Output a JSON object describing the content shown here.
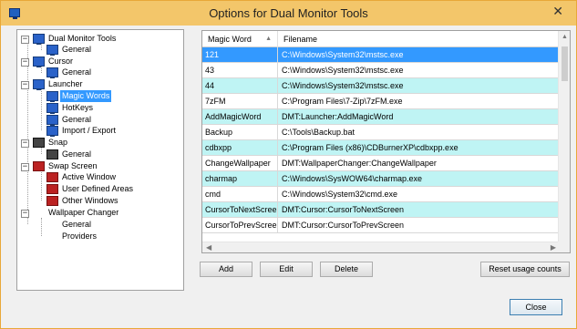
{
  "window": {
    "title": "Options for Dual Monitor Tools",
    "close_glyph": "✕"
  },
  "tree": {
    "nodes": [
      {
        "label": "Dual Monitor Tools",
        "icon": "monitor-icon",
        "expanded": true
      },
      {
        "label": "General",
        "icon": "monitor-icon"
      },
      {
        "label": "Cursor",
        "icon": "monitor-icon",
        "expanded": true
      },
      {
        "label": "General",
        "icon": "monitor-icon"
      },
      {
        "label": "Launcher",
        "icon": "monitor-icon",
        "expanded": true
      },
      {
        "label": "Magic Words",
        "icon": "monitor-icon",
        "selected": true
      },
      {
        "label": "HotKeys",
        "icon": "monitor-icon"
      },
      {
        "label": "General",
        "icon": "monitor-icon"
      },
      {
        "label": "Import / Export",
        "icon": "monitor-icon"
      },
      {
        "label": "Snap",
        "icon": "snap-icon",
        "expanded": true
      },
      {
        "label": "General",
        "icon": "snap-icon"
      },
      {
        "label": "Swap Screen",
        "icon": "swap-screen-icon",
        "expanded": true
      },
      {
        "label": "Active Window",
        "icon": "swap-screen-icon"
      },
      {
        "label": "User Defined Areas",
        "icon": "swap-screen-icon"
      },
      {
        "label": "Other Windows",
        "icon": "swap-screen-icon"
      },
      {
        "label": "Wallpaper Changer",
        "icon": "wallpaper-icon",
        "expanded": true
      },
      {
        "label": "General",
        "icon": "wallpaper-icon"
      },
      {
        "label": "Providers",
        "icon": "wallpaper-icon"
      }
    ]
  },
  "grid": {
    "columns": [
      "Magic Word",
      "Filename"
    ],
    "sort_glyph": "▲",
    "rows": [
      [
        "121",
        "C:\\Windows\\System32\\mstsc.exe"
      ],
      [
        "43",
        "C:\\Windows\\System32\\mstsc.exe"
      ],
      [
        "44",
        "C:\\Windows\\System32\\mstsc.exe"
      ],
      [
        "7zFM",
        "C:\\Program Files\\7-Zip\\7zFM.exe"
      ],
      [
        "AddMagicWord",
        "DMT:Launcher:AddMagicWord"
      ],
      [
        "Backup",
        "C:\\Tools\\Backup.bat"
      ],
      [
        "cdbxpp",
        "C:\\Program Files (x86)\\CDBurnerXP\\cdbxpp.exe"
      ],
      [
        "ChangeWallpaper",
        "DMT:WallpaperChanger:ChangeWallpaper"
      ],
      [
        "charmap",
        "C:\\Windows\\SysWOW64\\charmap.exe"
      ],
      [
        "cmd",
        "C:\\Windows\\System32\\cmd.exe"
      ],
      [
        "CursorToNextScreen",
        "DMT:Cursor:CursorToNextScreen"
      ],
      [
        "CursorToPrevScreen",
        "DMT:Cursor:CursorToPrevScreen"
      ]
    ]
  },
  "buttons": {
    "add": "Add",
    "edit": "Edit",
    "delete": "Delete",
    "reset_usage": "Reset usage counts",
    "close": "Close"
  },
  "colors": {
    "title_bar": "#f3c66a",
    "selection": "#3399ff",
    "alt_row": "#bff4f4"
  }
}
